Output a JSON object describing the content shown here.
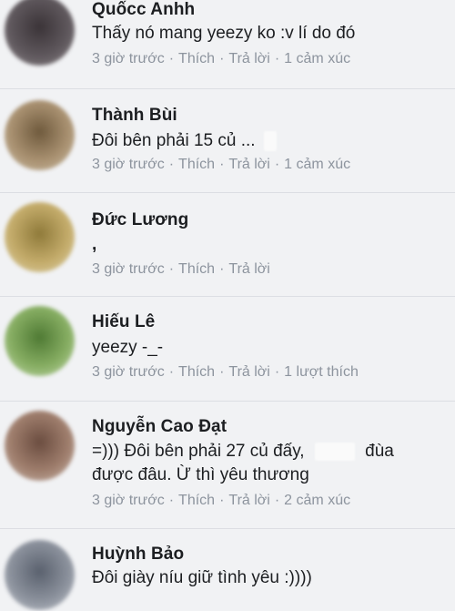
{
  "comments": [
    {
      "name": "Quốcc Anhh",
      "text": "Thấy nó mang yeezy ko :v lí do đó",
      "time": "3 giờ trước",
      "like": "Thích",
      "reply": "Trả lời",
      "reactions": "1 cảm xúc",
      "avatar_color": "#4a4448"
    },
    {
      "name": "Thành Bùi",
      "text": "Đôi bên phải 15 củ ...",
      "time": "3 giờ trước",
      "like": "Thích",
      "reply": "Trả lời",
      "reactions": "1 cảm xúc",
      "avatar_color": "#9c8660"
    },
    {
      "name": "Đức Lương",
      "text": ",",
      "time": "3 giờ trước",
      "like": "Thích",
      "reply": "Trả lời",
      "avatar_color": "#b59b52"
    },
    {
      "name": "Hiếu Lê",
      "text": "yeezy -_-",
      "time": "3 giờ trước",
      "like": "Thích",
      "reply": "Trả lời",
      "reactions": "1 lượt thích",
      "avatar_color": "#6f9550"
    },
    {
      "name": "Nguyễn Cao Đạt",
      "text_line1": "=))) Đôi bên phải 27 củ đấy,",
      "text_line1_end": "đùa",
      "text_line2": "được đâu. Ừ thì yêu thương",
      "time": "3 giờ trước",
      "like": "Thích",
      "reply": "Trả lời",
      "reactions": "2 cảm xúc",
      "avatar_color": "#8a6a5c"
    },
    {
      "name": "Huỳnh Bảo",
      "text": "Đôi giày níu giữ tình yêu :))))",
      "avatar_color": "#7a8290"
    }
  ]
}
